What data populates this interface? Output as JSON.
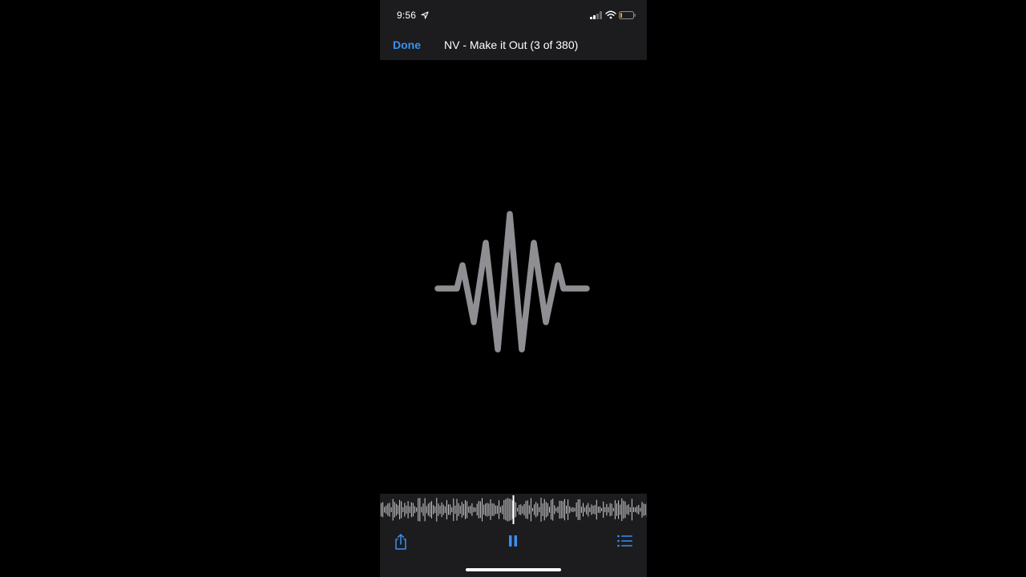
{
  "status_bar": {
    "time": "9:56",
    "icons": [
      "location-arrow-icon",
      "cellular-signal-icon",
      "wifi-icon",
      "battery-icon"
    ]
  },
  "nav": {
    "done_label": "Done",
    "title": "NV - Make it Out (3 of 380)"
  },
  "artwork": {
    "icon": "waveform-icon",
    "color": "#8e8e93"
  },
  "playback": {
    "state": "playing",
    "progress": 0.5
  },
  "toolbar": {
    "icons": [
      "share-icon",
      "pause-icon",
      "list-icon"
    ]
  },
  "colors": {
    "accent": "#3b8ff0",
    "bar_background": "#1c1c1e",
    "background": "#000000"
  }
}
